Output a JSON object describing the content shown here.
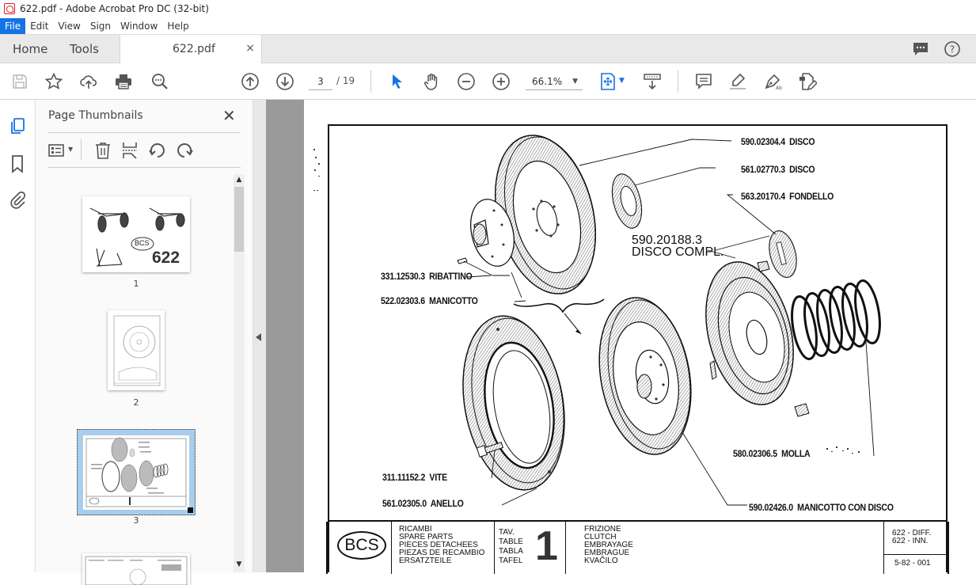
{
  "window": {
    "title": "622.pdf - Adobe Acrobat Pro DC (32-bit)"
  },
  "menu": {
    "items": [
      "File",
      "Edit",
      "View",
      "Sign",
      "Window",
      "Help"
    ]
  },
  "tabs": {
    "home": "Home",
    "tools": "Tools",
    "document": "622.pdf",
    "close": "×"
  },
  "toolbar": {
    "current_page": "3",
    "total_pages": "/ 19",
    "zoom": "66.1%",
    "accent": "#1473e6"
  },
  "panel": {
    "title": "Page Thumbnails",
    "close": "✕",
    "thumbnails": [
      {
        "label": "1",
        "cover_text": "622",
        "logo": "BCS",
        "selected": false
      },
      {
        "label": "2",
        "selected": false
      },
      {
        "label": "3",
        "selected": true
      },
      {
        "label": "",
        "selected": false
      }
    ],
    "selection_color": "#a9cdea"
  },
  "document": {
    "callouts": [
      {
        "code": "590.02304.4",
        "name": "DISCO"
      },
      {
        "code": "561.02770.3",
        "name": "DISCO"
      },
      {
        "code": "563.20170.4",
        "name": "FONDELLO"
      },
      {
        "code": "590.20188.3",
        "name": "DISCO COMPL."
      },
      {
        "code": "331.12530.3",
        "name": "RIBATTINO"
      },
      {
        "code": "522.02303.6",
        "name": "MANICOTTO"
      },
      {
        "code": "580.02306.5",
        "name": "MOLLA"
      },
      {
        "code": "311.11152.2",
        "name": "VITE"
      },
      {
        "code": "561.02305.0",
        "name": "ANELLO"
      },
      {
        "code": "590.02426.0",
        "name": "MANICOTTO CON DISCO"
      }
    ],
    "titleblock": {
      "logo": "BCS",
      "spare_parts": [
        "RICAMBI",
        "SPARE PARTS",
        "PIECES DETACHEES",
        "PIEZAS DE RECAMBIO",
        "ERSATZTEILE"
      ],
      "table_words": [
        "TAV.",
        "TABLE",
        "TABLA",
        "TAFEL"
      ],
      "table_number": "1",
      "section": [
        "FRIZIONE",
        "CLUTCH",
        "EMBRAYAGE",
        "EMBRAGUE",
        "KVAČILO"
      ],
      "models": [
        "622 - DIFF.",
        "622 - INN."
      ],
      "code": "5-82 - 001"
    }
  }
}
